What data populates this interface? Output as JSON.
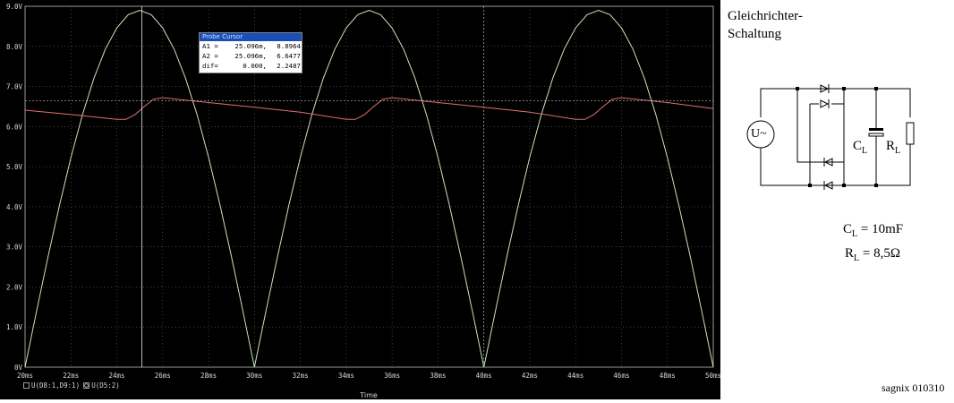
{
  "chart_data": {
    "type": "line",
    "xlabel": "Time",
    "ylabel": "",
    "xlim": [
      20,
      50
    ],
    "ylim": [
      0,
      9
    ],
    "x_unit": "ms",
    "x_ticks": [
      "20ms",
      "22ms",
      "24ms",
      "26ms",
      "28ms",
      "30ms",
      "32ms",
      "34ms",
      "36ms",
      "38ms",
      "40ms",
      "42ms",
      "44ms",
      "46ms",
      "48ms",
      "50ms"
    ],
    "y_ticks": [
      "0V",
      "1.0V",
      "2.0V",
      "3.0V",
      "4.0V",
      "5.0V",
      "6.0V",
      "7.0V",
      "8.0V",
      "9.0V"
    ],
    "grid": true,
    "series": [
      {
        "name": "U(D8:1,D9:1)",
        "color": "#c8e6b4",
        "x": [
          20,
          20.5,
          21,
          21.5,
          22,
          22.5,
          23,
          23.5,
          24,
          24.5,
          25,
          25.5,
          26,
          26.5,
          27,
          27.5,
          28,
          28.5,
          29,
          29.5,
          30,
          30.5,
          31,
          31.5,
          32,
          32.5,
          33,
          33.5,
          34,
          34.5,
          35,
          35.5,
          36,
          36.5,
          37,
          37.5,
          38,
          38.5,
          39,
          39.5,
          40,
          40.5,
          41,
          41.5,
          42,
          42.5,
          43,
          43.5,
          44,
          44.5,
          45,
          45.5,
          46,
          46.5,
          47,
          47.5,
          48,
          48.5,
          49,
          49.5,
          50
        ],
        "y": [
          0,
          1.39,
          2.75,
          4.04,
          5.23,
          6.29,
          7.2,
          7.93,
          8.46,
          8.79,
          8.9,
          8.79,
          8.46,
          7.93,
          7.2,
          6.29,
          5.23,
          4.04,
          2.75,
          1.39,
          0,
          1.39,
          2.75,
          4.04,
          5.23,
          6.29,
          7.2,
          7.93,
          8.46,
          8.79,
          8.9,
          8.79,
          8.46,
          7.93,
          7.2,
          6.29,
          5.23,
          4.04,
          2.75,
          1.39,
          0,
          1.39,
          2.75,
          4.04,
          5.23,
          6.29,
          7.2,
          7.93,
          8.46,
          8.79,
          8.9,
          8.79,
          8.46,
          7.93,
          7.2,
          6.29,
          5.23,
          4.04,
          2.75,
          1.39,
          0
        ]
      },
      {
        "name": "U(D5:2)",
        "color": "#e07070",
        "x": [
          20,
          22,
          24,
          24.4,
          24.8,
          25.2,
          25.6,
          26,
          28,
          30,
          32,
          34,
          34.4,
          34.8,
          35.2,
          35.6,
          36,
          38,
          40,
          42,
          44,
          44.4,
          44.8,
          45.2,
          45.6,
          46,
          48,
          50
        ],
        "y": [
          6.41,
          6.3,
          6.18,
          6.18,
          6.3,
          6.5,
          6.68,
          6.72,
          6.6,
          6.48,
          6.36,
          6.18,
          6.18,
          6.3,
          6.5,
          6.68,
          6.72,
          6.6,
          6.48,
          6.36,
          6.18,
          6.18,
          6.3,
          6.5,
          6.68,
          6.72,
          6.6,
          6.45
        ]
      }
    ],
    "cursors": {
      "a1_x": 25.096,
      "a2_y": 6.6477
    }
  },
  "probe_cursor": {
    "title": "Probe Cursor",
    "rows": [
      {
        "label": "A1 =",
        "x": "25.096m,",
        "y": "8.8964"
      },
      {
        "label": "A2 =",
        "x": "25.096m,",
        "y": "6.6477"
      },
      {
        "label": "dif=",
        "x": "0.000,",
        "y": "2.2487"
      }
    ]
  },
  "legend": [
    {
      "name": "U(D8:1,D9:1)",
      "symbol": "square"
    },
    {
      "name": "U(D5:2)",
      "symbol": "diamond"
    }
  ],
  "schematic": {
    "title_line1": "Gleichrichter-",
    "title_line2": "Schaltung",
    "source_label": "U~",
    "cap_label": "C",
    "cap_sub": "L",
    "res_label": "R",
    "res_sub": "L",
    "eq_c_sym": "C",
    "eq_c_sub": "L",
    "eq_c_val": " = 10mF",
    "eq_r_sym": "R",
    "eq_r_sub": "L",
    "eq_r_val": " = 8,5Ω"
  },
  "credit": "sagnix 010310"
}
